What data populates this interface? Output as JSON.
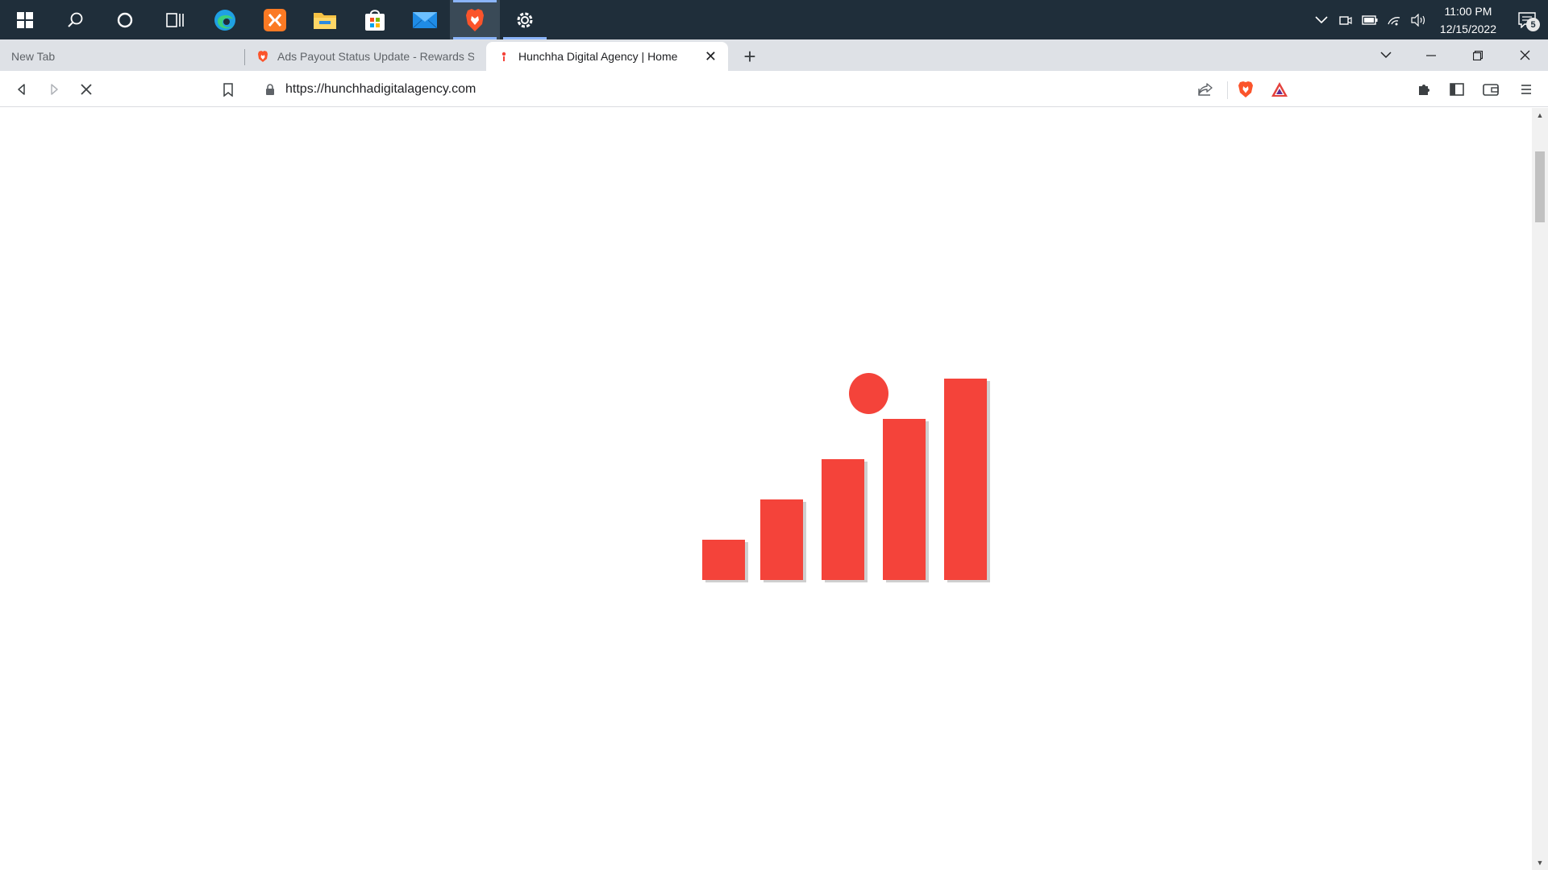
{
  "taskbar": {
    "apps": [
      {
        "name": "windows-start-icon"
      },
      {
        "name": "search-icon"
      },
      {
        "name": "cortana-icon"
      },
      {
        "name": "task-view-icon"
      },
      {
        "name": "edge-icon"
      },
      {
        "name": "xampp-icon"
      },
      {
        "name": "file-explorer-icon"
      },
      {
        "name": "store-icon"
      },
      {
        "name": "mail-icon"
      },
      {
        "name": "brave-icon"
      },
      {
        "name": "settings-icon"
      }
    ],
    "clock": {
      "time": "11:00 PM",
      "date": "12/15/2022"
    },
    "notification_count": "5"
  },
  "tabs": [
    {
      "title": "New Tab",
      "active": false
    },
    {
      "title": "Ads Payout Status Update - Rewards S",
      "active": false
    },
    {
      "title": "Hunchha Digital Agency | Home",
      "active": true
    }
  ],
  "toolbar": {
    "url": "https://hunchhadigitalagency.com"
  },
  "colors": {
    "accent": "#f4433a",
    "taskbar": "#1f2e3a",
    "tabstrip": "#dee1e6"
  }
}
